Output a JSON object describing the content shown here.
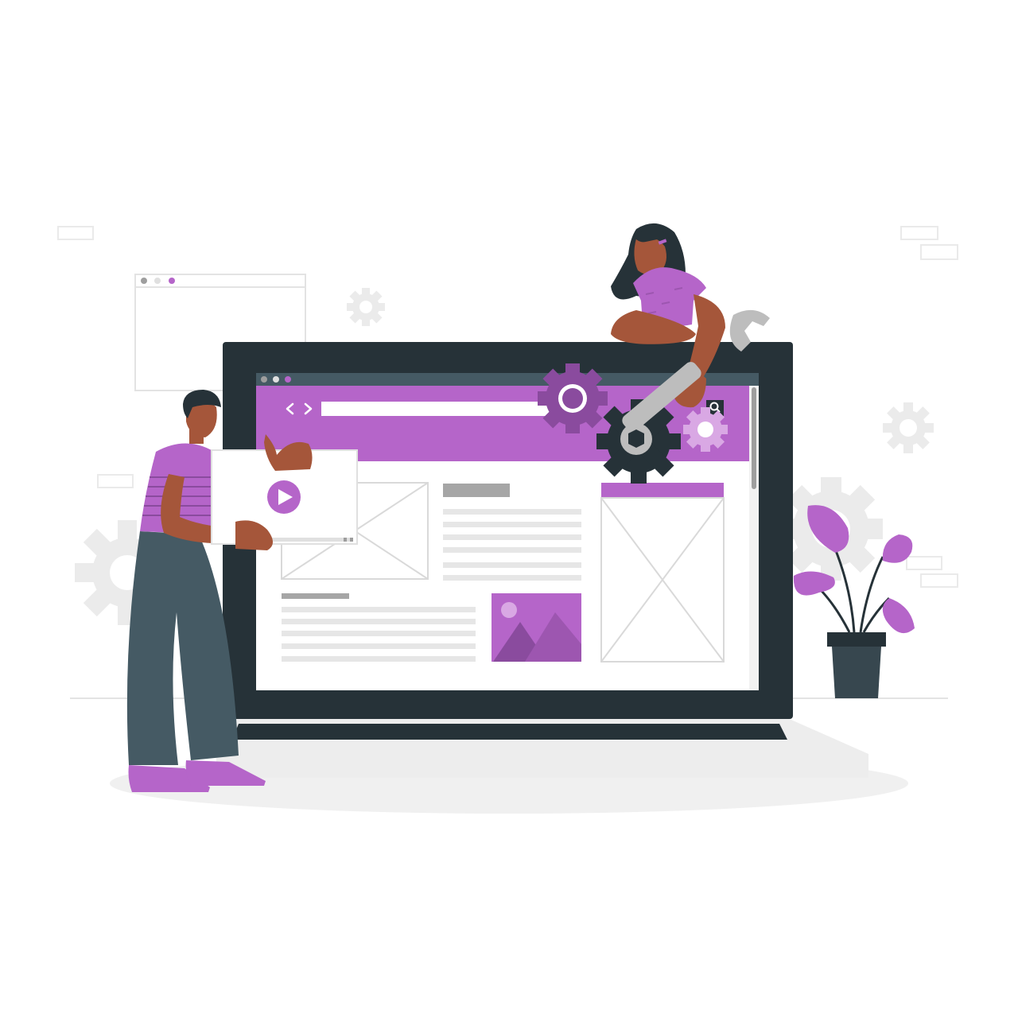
{
  "scene": {
    "kind": "illustration",
    "subject": "website-maintenance",
    "colors": {
      "accent": "#B565C9",
      "accent_dark": "#8A4B9E",
      "accent_light": "#D9A8E4",
      "screen_frame": "#263238",
      "pants": "#455A64",
      "skin": "#A5563A",
      "hair": "#263238",
      "wireframe_gray": "#E0E0E0",
      "heading_gray": "#A6A6A6",
      "background_gray": "#F2F2F2",
      "wrench": "#BDBDBD"
    },
    "icons": [
      "play-icon",
      "gear-icon",
      "wrench-icon",
      "search-icon",
      "chevron-left-icon",
      "chevron-right-icon",
      "image-placeholder-icon",
      "mountain-image-icon"
    ],
    "browser": {
      "window_dots": 3
    }
  }
}
